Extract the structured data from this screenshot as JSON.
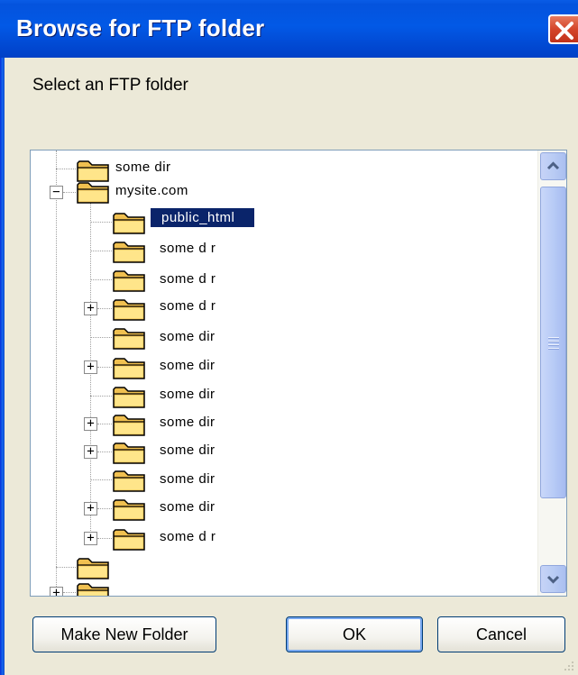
{
  "window": {
    "title": "Browse for FTP folder",
    "prompt": "Select an FTP folder"
  },
  "tree": {
    "nodes": [
      {
        "label": "some dir",
        "expander": "none"
      },
      {
        "label": "mysite.com",
        "expander": "−"
      },
      {
        "label": "public_html",
        "expander": "none",
        "selected": true
      },
      {
        "label": "some d r",
        "expander": "none"
      },
      {
        "label": "some d r",
        "expander": "none"
      },
      {
        "label": "some d r",
        "expander": "+"
      },
      {
        "label": "some dir",
        "expander": "none"
      },
      {
        "label": "some dir",
        "expander": "+"
      },
      {
        "label": "some dir",
        "expander": "none"
      },
      {
        "label": "some dir",
        "expander": "+"
      },
      {
        "label": "some dir",
        "expander": "+"
      },
      {
        "label": "some dir",
        "expander": "none"
      },
      {
        "label": "some dir",
        "expander": "+"
      },
      {
        "label": "some d r",
        "expander": "+"
      },
      {
        "label": "",
        "expander": "none"
      },
      {
        "label": "",
        "expander": "+"
      }
    ]
  },
  "buttons": {
    "make_new_folder": "Make New Folder",
    "ok": "OK",
    "cancel": "Cancel"
  },
  "colors": {
    "titlebar": "#0054e3",
    "selection": "#0a246a",
    "dialog_bg": "#ece9d8"
  }
}
